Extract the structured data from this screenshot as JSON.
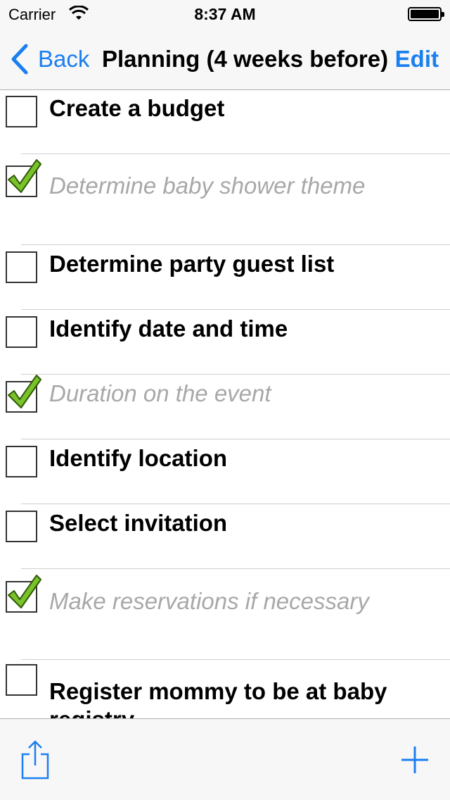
{
  "status_bar": {
    "carrier": "Carrier",
    "time": "8:37 AM"
  },
  "nav": {
    "back_label": "Back",
    "title": "Planning (4 weeks before)",
    "edit_label": "Edit"
  },
  "tasks": [
    {
      "label": "Create a budget",
      "checked": false
    },
    {
      "label": "Determine baby shower theme",
      "checked": true
    },
    {
      "label": "Determine party guest list",
      "checked": false
    },
    {
      "label": "Identify date and time",
      "checked": false
    },
    {
      "label": "Duration on the event",
      "checked": true
    },
    {
      "label": "Identify location",
      "checked": false
    },
    {
      "label": "Select invitation",
      "checked": false
    },
    {
      "label": "Make reservations if necessary",
      "checked": true
    },
    {
      "label": "Register mommy to be at baby registry",
      "checked": false
    }
  ],
  "colors": {
    "accent": "#1a7ff0",
    "checkmark": "#7ac22a",
    "done_text": "#a8a8a8"
  },
  "icons": {
    "back": "chevron-left-icon",
    "share": "share-icon",
    "add": "plus-icon",
    "check": "checkmark-icon"
  }
}
